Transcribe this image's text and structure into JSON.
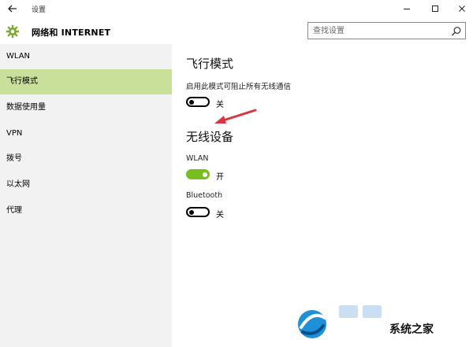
{
  "window": {
    "title": "设置"
  },
  "header": {
    "app_title": "网络和 INTERNET",
    "search_placeholder": "查找设置"
  },
  "sidebar": {
    "items": [
      {
        "label": "WLAN"
      },
      {
        "label": "飞行模式",
        "selected": true
      },
      {
        "label": "数据使用量"
      },
      {
        "label": "VPN"
      },
      {
        "label": "拨号"
      },
      {
        "label": "以太网"
      },
      {
        "label": "代理"
      }
    ]
  },
  "main": {
    "airplane": {
      "title": "飞行模式",
      "description": "启用此模式可阻止所有无线通信",
      "state_label": "关",
      "on": false
    },
    "wireless": {
      "title": "无线设备",
      "wlan": {
        "label": "WLAN",
        "state_label": "开",
        "on": true
      },
      "bluetooth": {
        "label": "Bluetooth",
        "state_label": "关",
        "on": false
      }
    }
  },
  "watermark": {
    "text": "系统之家"
  },
  "colors": {
    "accent": "#78be20",
    "selected_bg": "#c9e09a",
    "sidebar_bg": "#f2f2f2",
    "arrow": "#d9363e"
  },
  "icons": [
    "back-arrow-icon",
    "minimize-icon",
    "maximize-icon",
    "close-icon",
    "gear-icon",
    "search-icon"
  ]
}
